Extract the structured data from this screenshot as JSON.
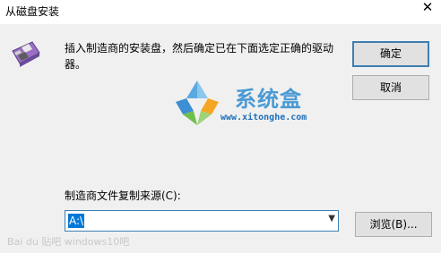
{
  "window": {
    "title": "从磁盘安装",
    "close_glyph": "✕"
  },
  "message": "插入制造商的安装盘，然后确定已在下面选定正确的驱动器。",
  "buttons": {
    "ok": "确定",
    "cancel": "取消",
    "browse": "浏览(B)..."
  },
  "watermark": {
    "brand": "系统盒",
    "url": "www.xitonghe.com",
    "corner": "Bai du 贴吧  windows10吧"
  },
  "copy_source": {
    "label": "制造商文件复制来源(C):",
    "value": "A:\\"
  },
  "icons": {
    "disk": "floppy-disk-icon",
    "dropdown": "chevron-down-icon"
  }
}
